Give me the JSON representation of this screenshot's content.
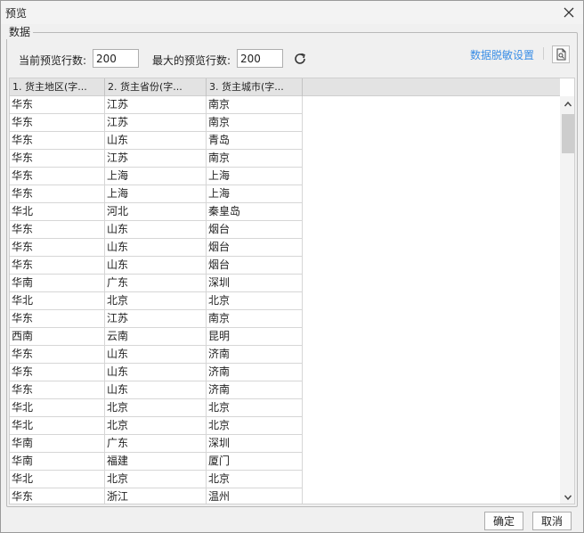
{
  "dialog": {
    "title": "预览",
    "ok_label": "确定",
    "cancel_label": "取消"
  },
  "section": {
    "legend": "数据",
    "current_rows_label": "当前预览行数:",
    "current_rows_value": "200",
    "max_rows_label": "最大的预览行数:",
    "max_rows_value": "200",
    "desensitize_link": "数据脱敏设置"
  },
  "table": {
    "columns": [
      "1. 货主地区(字...",
      "2. 货主省份(字...",
      "3. 货主城市(字..."
    ],
    "rows": [
      [
        "华东",
        "江苏",
        "南京"
      ],
      [
        "华东",
        "江苏",
        "南京"
      ],
      [
        "华东",
        "山东",
        "青岛"
      ],
      [
        "华东",
        "江苏",
        "南京"
      ],
      [
        "华东",
        "上海",
        "上海"
      ],
      [
        "华东",
        "上海",
        "上海"
      ],
      [
        "华北",
        "河北",
        "秦皇岛"
      ],
      [
        "华东",
        "山东",
        "烟台"
      ],
      [
        "华东",
        "山东",
        "烟台"
      ],
      [
        "华东",
        "山东",
        "烟台"
      ],
      [
        "华南",
        "广东",
        "深圳"
      ],
      [
        "华北",
        "北京",
        "北京"
      ],
      [
        "华东",
        "江苏",
        "南京"
      ],
      [
        "西南",
        "云南",
        "昆明"
      ],
      [
        "华东",
        "山东",
        "济南"
      ],
      [
        "华东",
        "山东",
        "济南"
      ],
      [
        "华东",
        "山东",
        "济南"
      ],
      [
        "华北",
        "北京",
        "北京"
      ],
      [
        "华北",
        "北京",
        "北京"
      ],
      [
        "华南",
        "广东",
        "深圳"
      ],
      [
        "华南",
        "福建",
        "厦门"
      ],
      [
        "华北",
        "北京",
        "北京"
      ],
      [
        "华东",
        "浙江",
        "温州"
      ]
    ]
  },
  "icons": {
    "close": "close-icon",
    "refresh": "refresh-icon",
    "preview": "document-search-icon",
    "scroll_up": "chevron-up-icon",
    "scroll_down": "chevron-down-icon"
  },
  "colors": {
    "link": "#3a8ee6",
    "header_bg": "#e3e3e3",
    "dialog_bg": "#f0f0f0"
  }
}
